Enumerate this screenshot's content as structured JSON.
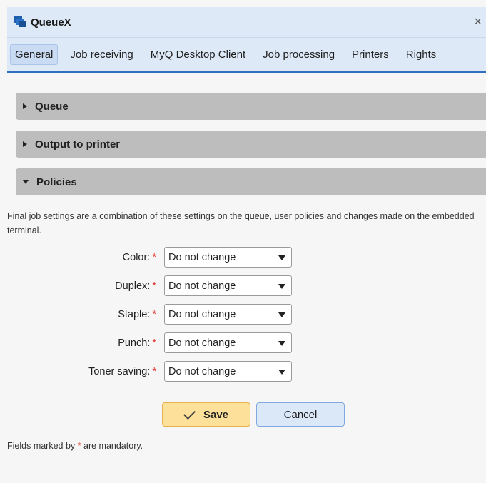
{
  "window": {
    "title": "QueueX",
    "close_label": "×",
    "icon": "queue-app-icon"
  },
  "tabs": [
    {
      "label": "General",
      "active": true
    },
    {
      "label": "Job receiving",
      "active": false
    },
    {
      "label": "MyQ Desktop Client",
      "active": false
    },
    {
      "label": "Job processing",
      "active": false
    },
    {
      "label": "Printers",
      "active": false
    },
    {
      "label": "Rights",
      "active": false
    }
  ],
  "sections": [
    {
      "label": "Queue",
      "expanded": false
    },
    {
      "label": "Output to printer",
      "expanded": false
    },
    {
      "label": "Policies",
      "expanded": true
    }
  ],
  "policies": {
    "description": "Final job settings are a combination of these settings on the queue, user policies and changes made on the embedded terminal.",
    "required_mark": "*",
    "fields": [
      {
        "label": "Color:",
        "value": "Do not change"
      },
      {
        "label": "Duplex:",
        "value": "Do not change"
      },
      {
        "label": "Staple:",
        "value": "Do not change"
      },
      {
        "label": "Punch:",
        "value": "Do not change"
      },
      {
        "label": "Toner saving:",
        "value": "Do not change"
      }
    ]
  },
  "actions": {
    "save_label": "Save",
    "cancel_label": "Cancel"
  },
  "footnote": {
    "prefix": "Fields marked by ",
    "mark": "*",
    "suffix": " are mandatory."
  },
  "colors": {
    "title_bar": "#dde9f7",
    "accent": "#2f6fbe",
    "section_header": "#bdbdbd",
    "save_button": "#fde19a",
    "cancel_button": "#dbe8f8",
    "required": "#e0322a"
  }
}
